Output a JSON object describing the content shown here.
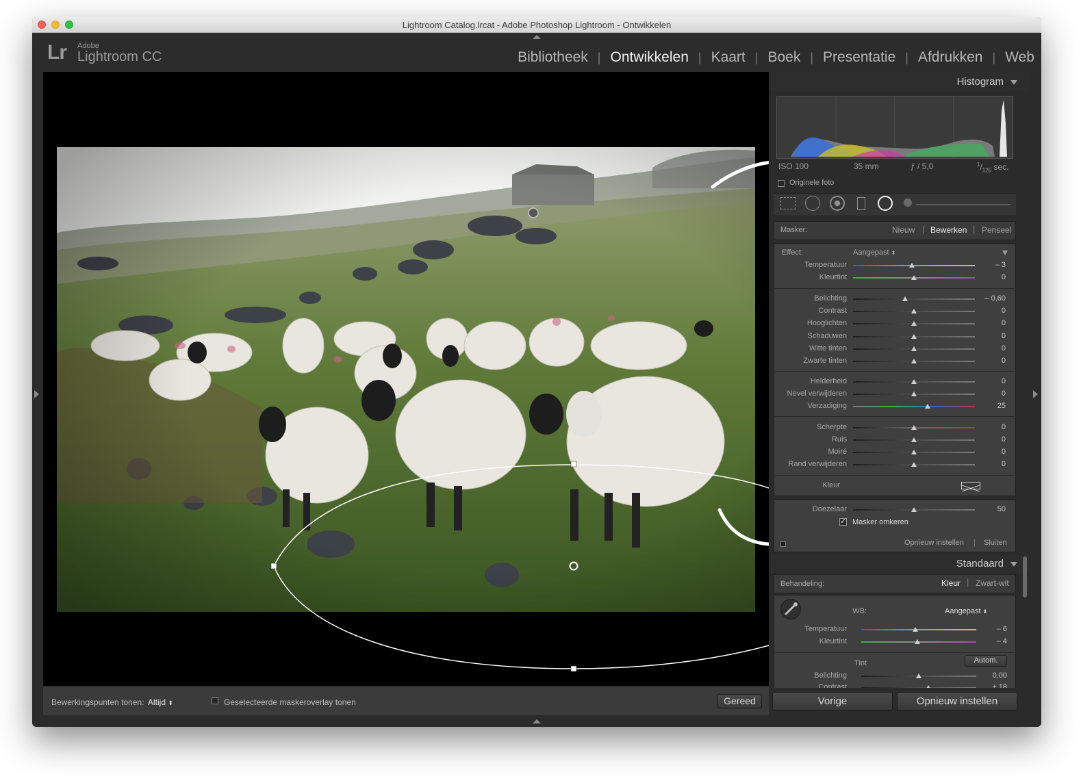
{
  "window": {
    "title": "Lightroom Catalog.lrcat - Adobe Photoshop Lightroom - Ontwikkelen"
  },
  "brand": {
    "mark": "Lr",
    "adobe": "Adobe",
    "product": "Lightroom CC"
  },
  "modules": [
    "Bibliotheek",
    "Ontwikkelen",
    "Kaart",
    "Boek",
    "Presentatie",
    "Afdrukken",
    "Web"
  ],
  "active_module": "Ontwikkelen",
  "toolbar": {
    "show_pins_label": "Bewerkingspunten tonen:",
    "show_pins_value": "Altijd",
    "overlay_label": "Geselecteerde maskeroverlay tonen",
    "done_label": "Gereed"
  },
  "histogram": {
    "title": "Histogram",
    "iso": "ISO 100",
    "focal": "35 mm",
    "aperture": "ƒ / 5,0",
    "shutter_num": "1",
    "shutter_den": "125",
    "shutter_unit": "sec.",
    "original_photo": "Originele foto"
  },
  "mask": {
    "label": "Masker:",
    "new": "Nieuw",
    "edit": "Bewerken",
    "brush": "Penseel"
  },
  "effect": {
    "label": "Effect:",
    "value": "Aangepast"
  },
  "sliders": {
    "temp": {
      "label": "Temperatuur",
      "value": "– 3"
    },
    "tint": {
      "label": "Kleurtint",
      "value": "0"
    },
    "exposure": {
      "label": "Belichting",
      "value": "– 0,60"
    },
    "contrast": {
      "label": "Contrast",
      "value": "0"
    },
    "highlights": {
      "label": "Hooglichten",
      "value": "0"
    },
    "shadows": {
      "label": "Schaduwen",
      "value": "0"
    },
    "whites": {
      "label": "Witte tinten",
      "value": "0"
    },
    "blacks": {
      "label": "Zwarte tinten",
      "value": "0"
    },
    "clarity": {
      "label": "Helderheid",
      "value": "0"
    },
    "dehaze": {
      "label": "Nevel verwijderen",
      "value": "0"
    },
    "saturation": {
      "label": "Verzadiging",
      "value": "25"
    },
    "sharpness": {
      "label": "Scherpte",
      "value": "0"
    },
    "noise": {
      "label": "Ruis",
      "value": "0"
    },
    "moire": {
      "label": "Moiré",
      "value": "0"
    },
    "defringe": {
      "label": "Rand verwijderen",
      "value": "0"
    },
    "color": {
      "label": "Kleur"
    },
    "feather": {
      "label": "Doezelaar",
      "value": "50"
    }
  },
  "invert_mask": {
    "label": "Masker omkeren",
    "checked": true
  },
  "mask_footer": {
    "reset": "Opnieuw instellen",
    "close": "Sluiten"
  },
  "basic": {
    "title": "Standaard",
    "treatment_label": "Behandeling:",
    "color": "Kleur",
    "bw": "Zwart-wit",
    "wb_label": "WB:",
    "wb_value": "Aangepast",
    "temp": {
      "label": "Temperatuur",
      "value": "– 6"
    },
    "tint": {
      "label": "Kleurtint",
      "value": "– 4"
    },
    "tone_label": "Tint",
    "auto": "Autom.",
    "exposure": {
      "label": "Belichting",
      "value": "0,00"
    },
    "contrast": {
      "label": "Contrast",
      "value": "+ 18"
    }
  },
  "bottom_buttons": {
    "previous": "Vorige",
    "reset": "Opnieuw instellen"
  },
  "colors": {
    "panel_bg": "#2b2b2b",
    "subpanel_bg": "#3f3f3f",
    "active_text": "#f2f2f2",
    "inactive_text": "#b7b7b7"
  }
}
